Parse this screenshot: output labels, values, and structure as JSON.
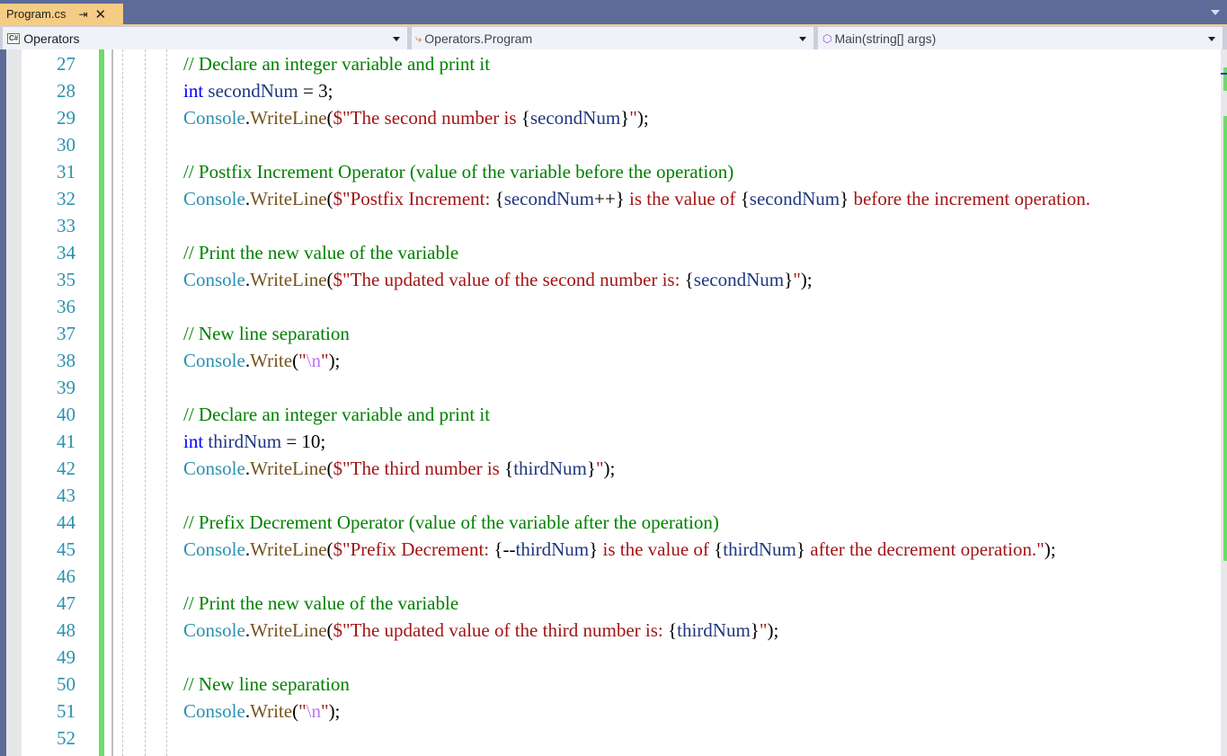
{
  "tab": {
    "title": "Program.cs",
    "pin_icon": "pin-icon",
    "close_icon": "close-icon"
  },
  "nav": {
    "project": "Operators",
    "project_icon": "csharp-project-icon",
    "type": "Operators.Program",
    "type_icon": "class-icon",
    "member": "Main(string[] args)",
    "member_icon": "private-method-icon"
  },
  "colors": {
    "tab_active": "#f5cc84",
    "chrome": "#5d6b99",
    "change_bar": "#6ddc6a",
    "line_number": "#2b91af",
    "comment": "#008000",
    "keyword": "#0000ff",
    "string": "#a31515",
    "type": "#2b91af",
    "method": "#74531f",
    "variable": "#1f377f"
  },
  "lines": [
    {
      "n": "27",
      "tokens": [
        {
          "t": "// Declare an integer variable and print it",
          "c": "cm"
        }
      ]
    },
    {
      "n": "28",
      "tokens": [
        {
          "t": "int",
          "c": "kw"
        },
        {
          "t": " ",
          "c": "op"
        },
        {
          "t": "secondNum",
          "c": "id"
        },
        {
          "t": " = 3;",
          "c": "op"
        }
      ]
    },
    {
      "n": "29",
      "tokens": [
        {
          "t": "Console",
          "c": "cls"
        },
        {
          "t": ".",
          "c": "op"
        },
        {
          "t": "WriteLine",
          "c": "mth"
        },
        {
          "t": "(",
          "c": "op"
        },
        {
          "t": "$\"The second number is ",
          "c": "str"
        },
        {
          "t": "{",
          "c": "brace"
        },
        {
          "t": "secondNum",
          "c": "interp"
        },
        {
          "t": "}",
          "c": "brace"
        },
        {
          "t": "\"",
          "c": "str"
        },
        {
          "t": ");",
          "c": "op"
        }
      ]
    },
    {
      "n": "30",
      "tokens": []
    },
    {
      "n": "31",
      "tokens": [
        {
          "t": "// Postfix Increment Operator (value of the variable before the operation)",
          "c": "cm"
        }
      ]
    },
    {
      "n": "32",
      "tokens": [
        {
          "t": "Console",
          "c": "cls"
        },
        {
          "t": ".",
          "c": "op"
        },
        {
          "t": "WriteLine",
          "c": "mth"
        },
        {
          "t": "(",
          "c": "op"
        },
        {
          "t": "$\"Postfix Increment: ",
          "c": "str"
        },
        {
          "t": "{",
          "c": "brace"
        },
        {
          "t": "secondNum",
          "c": "interp"
        },
        {
          "t": "++",
          "c": "op"
        },
        {
          "t": "}",
          "c": "brace"
        },
        {
          "t": " is the value of ",
          "c": "str"
        },
        {
          "t": "{",
          "c": "brace"
        },
        {
          "t": "secondNum",
          "c": "interp"
        },
        {
          "t": "}",
          "c": "brace"
        },
        {
          "t": " before the increment operation.",
          "c": "str"
        }
      ]
    },
    {
      "n": "33",
      "tokens": []
    },
    {
      "n": "34",
      "tokens": [
        {
          "t": "// Print the new value of the variable",
          "c": "cm"
        }
      ]
    },
    {
      "n": "35",
      "tokens": [
        {
          "t": "Console",
          "c": "cls"
        },
        {
          "t": ".",
          "c": "op"
        },
        {
          "t": "WriteLine",
          "c": "mth"
        },
        {
          "t": "(",
          "c": "op"
        },
        {
          "t": "$\"The updated value of the second number is: ",
          "c": "str"
        },
        {
          "t": "{",
          "c": "brace"
        },
        {
          "t": "secondNum",
          "c": "interp"
        },
        {
          "t": "}",
          "c": "brace"
        },
        {
          "t": "\"",
          "c": "str"
        },
        {
          "t": ");",
          "c": "op"
        }
      ]
    },
    {
      "n": "36",
      "tokens": []
    },
    {
      "n": "37",
      "tokens": [
        {
          "t": "// New line separation",
          "c": "cm"
        }
      ]
    },
    {
      "n": "38",
      "tokens": [
        {
          "t": "Console",
          "c": "cls"
        },
        {
          "t": ".",
          "c": "op"
        },
        {
          "t": "Write",
          "c": "mth"
        },
        {
          "t": "(",
          "c": "op"
        },
        {
          "t": "\"",
          "c": "str"
        },
        {
          "t": "\\n",
          "c": "esc"
        },
        {
          "t": "\"",
          "c": "str"
        },
        {
          "t": ");",
          "c": "op"
        }
      ]
    },
    {
      "n": "39",
      "tokens": []
    },
    {
      "n": "40",
      "tokens": [
        {
          "t": "// Declare an integer variable and print it",
          "c": "cm"
        }
      ]
    },
    {
      "n": "41",
      "tokens": [
        {
          "t": "int",
          "c": "kw"
        },
        {
          "t": " ",
          "c": "op"
        },
        {
          "t": "thirdNum",
          "c": "id"
        },
        {
          "t": " = 10;",
          "c": "op"
        }
      ]
    },
    {
      "n": "42",
      "tokens": [
        {
          "t": "Console",
          "c": "cls"
        },
        {
          "t": ".",
          "c": "op"
        },
        {
          "t": "WriteLine",
          "c": "mth"
        },
        {
          "t": "(",
          "c": "op"
        },
        {
          "t": "$\"The third number is ",
          "c": "str"
        },
        {
          "t": "{",
          "c": "brace"
        },
        {
          "t": "thirdNum",
          "c": "interp"
        },
        {
          "t": "}",
          "c": "brace"
        },
        {
          "t": "\"",
          "c": "str"
        },
        {
          "t": ");",
          "c": "op"
        }
      ]
    },
    {
      "n": "43",
      "tokens": []
    },
    {
      "n": "44",
      "tokens": [
        {
          "t": "// Prefix Decrement Operator (value of the variable after the operation)",
          "c": "cm"
        }
      ]
    },
    {
      "n": "45",
      "tokens": [
        {
          "t": "Console",
          "c": "cls"
        },
        {
          "t": ".",
          "c": "op"
        },
        {
          "t": "WriteLine",
          "c": "mth"
        },
        {
          "t": "(",
          "c": "op"
        },
        {
          "t": "$\"Prefix Decrement: ",
          "c": "str"
        },
        {
          "t": "{",
          "c": "brace"
        },
        {
          "t": "--",
          "c": "op"
        },
        {
          "t": "thirdNum",
          "c": "interp"
        },
        {
          "t": "}",
          "c": "brace"
        },
        {
          "t": " is the value of ",
          "c": "str"
        },
        {
          "t": "{",
          "c": "brace"
        },
        {
          "t": "thirdNum",
          "c": "interp"
        },
        {
          "t": "}",
          "c": "brace"
        },
        {
          "t": " after the decrement operation.\"",
          "c": "str"
        },
        {
          "t": ");",
          "c": "op"
        }
      ]
    },
    {
      "n": "46",
      "tokens": []
    },
    {
      "n": "47",
      "tokens": [
        {
          "t": "// Print the new value of the variable",
          "c": "cm"
        }
      ]
    },
    {
      "n": "48",
      "tokens": [
        {
          "t": "Console",
          "c": "cls"
        },
        {
          "t": ".",
          "c": "op"
        },
        {
          "t": "WriteLine",
          "c": "mth"
        },
        {
          "t": "(",
          "c": "op"
        },
        {
          "t": "$\"The updated value of the third number is: ",
          "c": "str"
        },
        {
          "t": "{",
          "c": "brace"
        },
        {
          "t": "thirdNum",
          "c": "interp"
        },
        {
          "t": "}",
          "c": "brace"
        },
        {
          "t": "\"",
          "c": "str"
        },
        {
          "t": ");",
          "c": "op"
        }
      ]
    },
    {
      "n": "49",
      "tokens": []
    },
    {
      "n": "50",
      "tokens": [
        {
          "t": "// New line separation",
          "c": "cm"
        }
      ]
    },
    {
      "n": "51",
      "tokens": [
        {
          "t": "Console",
          "c": "cls"
        },
        {
          "t": ".",
          "c": "op"
        },
        {
          "t": "Write",
          "c": "mth"
        },
        {
          "t": "(",
          "c": "op"
        },
        {
          "t": "\"",
          "c": "str"
        },
        {
          "t": "\\n",
          "c": "esc"
        },
        {
          "t": "\"",
          "c": "str"
        },
        {
          "t": ");",
          "c": "op"
        }
      ]
    },
    {
      "n": "52",
      "tokens": []
    }
  ]
}
